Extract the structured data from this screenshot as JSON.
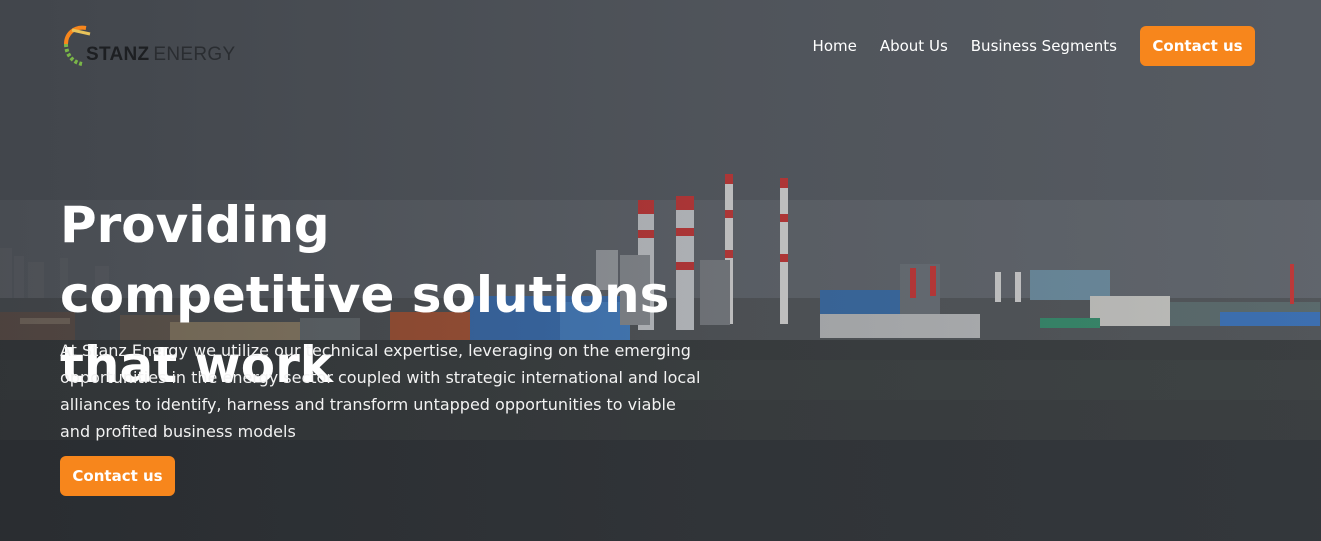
{
  "brand": {
    "name_part1": "STANZ",
    "name_part2": "ENERGY",
    "accent_color": "#f7861c"
  },
  "nav": {
    "items": [
      {
        "label": "Home"
      },
      {
        "label": "About Us"
      },
      {
        "label": "Business Segments"
      }
    ],
    "contact_label": "Contact us"
  },
  "hero": {
    "title": "Providing competitive solutions that work",
    "description": "At Stanz Energy we utilize our technical expertise, leveraging on the emerging opportunities in the energy sector coupled with strategic international and local alliances to identify, harness and transform untapped opportunities to viable and profited business models",
    "cta_label": "Contact us"
  }
}
